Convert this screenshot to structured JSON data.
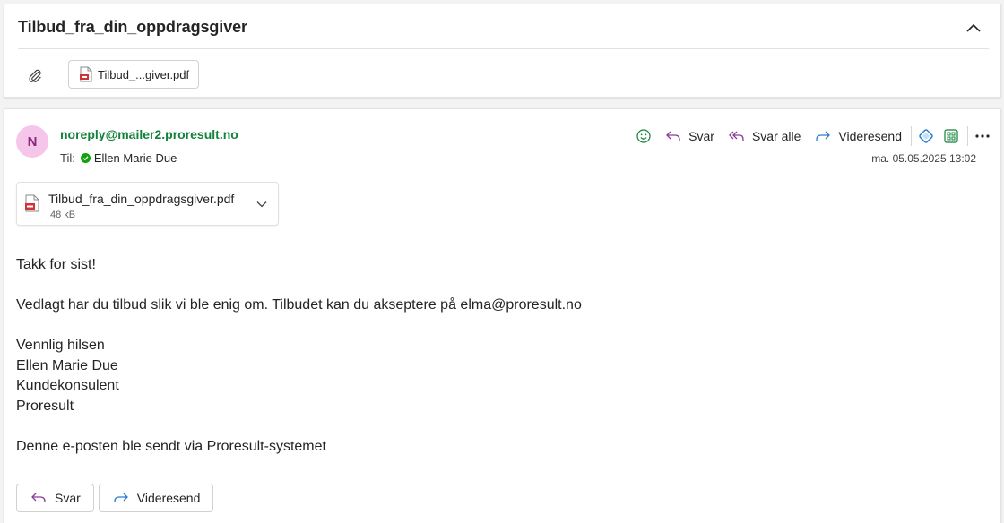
{
  "thread": {
    "title": "Tilbud_fra_din_oppdragsgiver",
    "attachment_chip": "Tilbud_...giver.pdf"
  },
  "message": {
    "avatar_initial": "N",
    "sender": "noreply@mailer2.proresult.no",
    "to_label": "Til:",
    "recipient": "Ellen Marie Due",
    "date": "ma. 05.05.2025 13:02",
    "toolbar": {
      "reply": "Svar",
      "reply_all": "Svar alle",
      "forward": "Videresend"
    },
    "attachment": {
      "name": "Tilbud_fra_din_oppdragsgiver.pdf",
      "size": "48 kB"
    },
    "body": {
      "greeting": "Takk for sist!",
      "paragraph": "Vedlagt har du tilbud slik vi ble enig om. Tilbudet kan du akseptere på elma@proresult.no",
      "closing": "Vennlig hilsen",
      "name": "Ellen Marie Due",
      "role": "Kundekonsulent",
      "company": "Proresult",
      "footer": "Denne e-posten ble sendt via Proresult-systemet"
    },
    "bottom": {
      "reply": "Svar",
      "forward": "Videresend"
    }
  },
  "colors": {
    "sender_green": "#13813b",
    "reply_purple": "#8a3b9a",
    "forward_blue": "#2b7cd3",
    "avatar_bg": "#f5c6ea"
  },
  "icons": [
    "chevron-up-icon",
    "paperclip-icon",
    "pdf-file-icon",
    "emoji-icon",
    "reply-icon",
    "reply-all-icon",
    "forward-icon",
    "loop-icon",
    "apps-icon",
    "more-icon",
    "chevron-down-icon",
    "presence-available-icon"
  ]
}
